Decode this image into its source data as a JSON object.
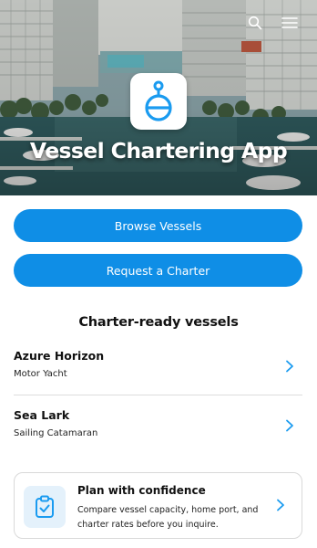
{
  "header": {
    "app_title": "Vessel Chartering App",
    "icons": {
      "search": "search-icon",
      "menu": "hamburger-menu-icon",
      "logo": "buoy-logo-icon"
    }
  },
  "actions": {
    "browse_label": "Browse Vessels",
    "request_label": "Request a Charter"
  },
  "vessels": {
    "title": "Charter-ready vessels",
    "items": [
      {
        "name": "Azure Horizon",
        "type": "Motor Yacht"
      },
      {
        "name": "Sea Lark",
        "type": "Sailing Catamaran"
      }
    ]
  },
  "info_card": {
    "title": "Plan with confidence",
    "body": "Compare vessel capacity, home port, and charter rates before you inquire.",
    "icon": "clipboard-check-icon"
  },
  "colors": {
    "accent": "#0f8ee6",
    "icon_blue": "#1a9bf0",
    "icon_bg": "#e4f1fb"
  }
}
